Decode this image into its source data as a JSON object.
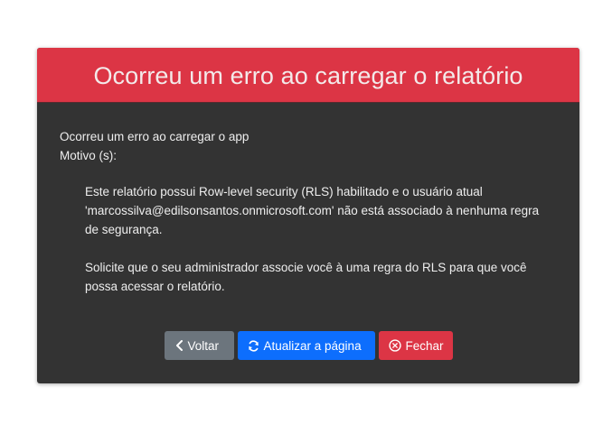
{
  "dialog": {
    "title": "Ocorreu um erro ao carregar o relatório",
    "error_line": "Ocorreu um erro ao carregar o app",
    "reason_label": "Motivo (s):",
    "reason_lines": [
      "Este relatório possui Row-level security (RLS) habilitado e o usuário atual",
      "'marcossilva@edilsonsantos.onmicrosoft.com' não está associado à nenhuma regra",
      "de segurança."
    ],
    "advice_lines": [
      "Solicite que o seu administrador associe você à uma regra do RLS para que você",
      "possa acessar o relatório."
    ]
  },
  "buttons": {
    "back": {
      "label": "Voltar",
      "icon": "chevron-left-icon",
      "color": "#6c757d"
    },
    "refresh": {
      "label": "Atualizar a página",
      "icon": "refresh-icon",
      "color": "#0d6efd"
    },
    "close": {
      "label": "Fechar",
      "icon": "close-circle-icon",
      "color": "#dc3545"
    }
  },
  "colors": {
    "header": "#dc3545",
    "body": "#333333"
  }
}
